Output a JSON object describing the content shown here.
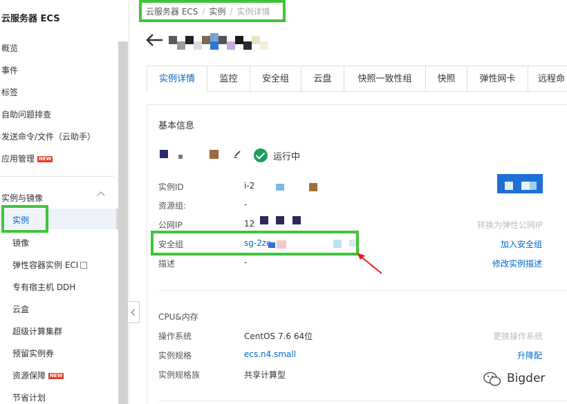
{
  "sidebar": {
    "title": "云服务器 ECS",
    "items_top": [
      "概览",
      "事件",
      "标签",
      "自助问题排查",
      "发送命令/文件（云助手）",
      "应用管理"
    ],
    "app_mgmt_badge": "NEW",
    "group_title": "实例与镜像",
    "group_items": [
      "实例",
      "镜像",
      "弹性容器实例 ECI",
      "专有宿主机 DDH",
      "云盒",
      "超级计算集群",
      "预留实例券",
      "资源保障",
      "节省计划"
    ],
    "resource_badge": "NEW"
  },
  "breadcrumb": [
    "云服务器 ECS",
    "实例",
    "实例详情"
  ],
  "tabs": [
    "实例详情",
    "监控",
    "安全组",
    "云盘",
    "快照一致性组",
    "快照",
    "弹性网卡",
    "远程命"
  ],
  "basic": {
    "section_title": "基本信息",
    "status": "运行中",
    "rows": [
      {
        "label": "实例ID",
        "value": "i-2"
      },
      {
        "label": "资源组:",
        "value": "-"
      },
      {
        "label": "公网IP",
        "value": "12"
      },
      {
        "label": "安全组",
        "value": "sg-2ze"
      },
      {
        "label": "描述",
        "value": "-"
      }
    ],
    "actions": {
      "convert_eip": "转换为弹性公网IP",
      "add_sg": "加入安全组",
      "edit_desc": "修改实例描述"
    }
  },
  "config": {
    "rows": [
      {
        "label": "CPU&内存",
        "value": ""
      },
      {
        "label": "操作系统",
        "value": "CentOS 7.6 64位"
      },
      {
        "label": "实例规格",
        "value": "ecs.n4.small"
      },
      {
        "label": "实例规格族",
        "value": "共享计算型"
      }
    ],
    "actions": {
      "change_os": "更换操作系统",
      "upgrade": "升降配"
    }
  },
  "watermark": "Bigder",
  "colors": {
    "accent": "#0068c9",
    "highlight": "#3dc53a",
    "arrow": "#e02020",
    "running": "#1a9e5c"
  }
}
